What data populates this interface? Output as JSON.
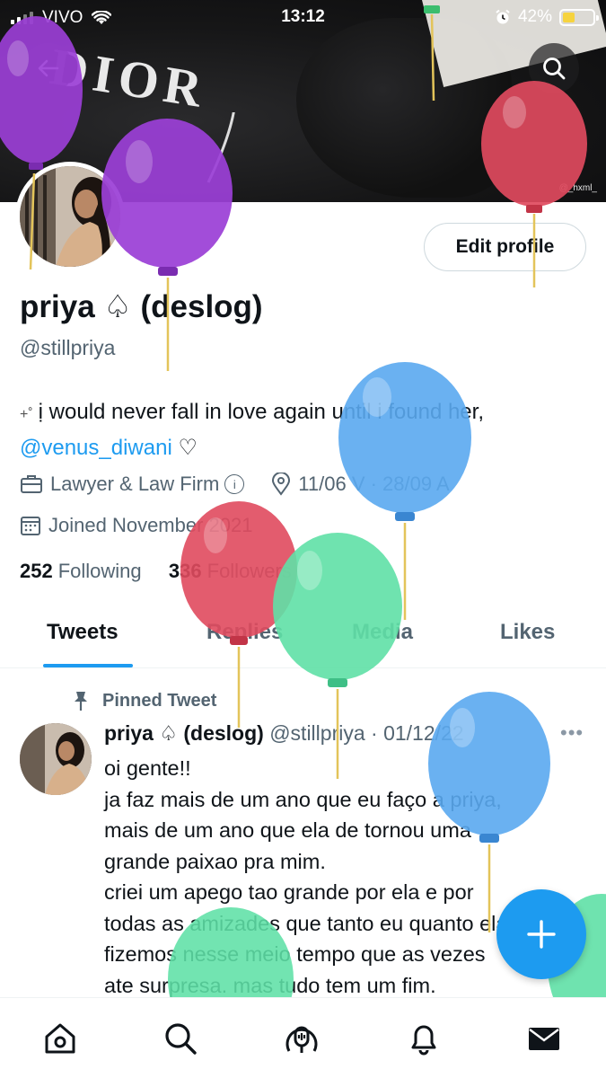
{
  "status_bar": {
    "carrier": "VIVO",
    "time": "13:12",
    "battery": "42%",
    "battery_level": 0.42
  },
  "banner": {
    "brand_text": "DIOR",
    "credit": "@_hxml_"
  },
  "profile": {
    "edit_label": "Edit profile",
    "name": "priya ♤ (deslog)",
    "handle": "@stillpriya",
    "bio_decoration": "+˚",
    "bio_text": "ị would never fall in love again until i found her,",
    "bio_mention": "@venus_diwani",
    "bio_heart": "♡",
    "category": "Lawyer & Law Firm",
    "info_glyph": "i",
    "location": "11/06 V · 28/09 A",
    "joined": "Joined November 2021",
    "following_count": "252",
    "following_label": "Following",
    "followers_count": "336",
    "followers_label": "Followers"
  },
  "tabs": [
    {
      "label": "Tweets",
      "active": true
    },
    {
      "label": "Replies",
      "active": false
    },
    {
      "label": "Media",
      "active": false
    },
    {
      "label": "Likes",
      "active": false
    }
  ],
  "pinned_tweet": {
    "pinned_label": "Pinned Tweet",
    "author_name": "priya ♤ (deslog)",
    "author_handle": "@stillpriya",
    "date": "· 01/12/22",
    "more": "•••",
    "lines": [
      "oi gente!!",
      "ja faz mais de um ano que eu faço a priya,",
      "mais de um ano que ela de tornou uma",
      "grande paixao pra mim.",
      "criei um apego tao grande por ela e por",
      "todas as amizades que tanto eu quanto ela",
      "fizemos nesse meio tempo que as vezes",
      "ate surpresa. mas tudo tem um fim."
    ]
  },
  "icons": {
    "back": "back-arrow-icon",
    "search": "search-icon",
    "briefcase": "briefcase-icon",
    "location": "location-pin-icon",
    "calendar": "calendar-icon",
    "pin": "pin-icon",
    "compose": "plus-icon",
    "home": "home-icon",
    "explore": "search-icon",
    "spaces": "spaces-icon",
    "notifications": "bell-icon",
    "messages": "envelope-icon"
  },
  "colors": {
    "accent": "#1d9bf0",
    "text": "#0f1419",
    "muted": "#536471",
    "balloon_purple": "#9b3fd6",
    "balloon_red": "#e04a5e",
    "balloon_blue": "#5aa8f0",
    "balloon_green": "#5fe0a6"
  }
}
